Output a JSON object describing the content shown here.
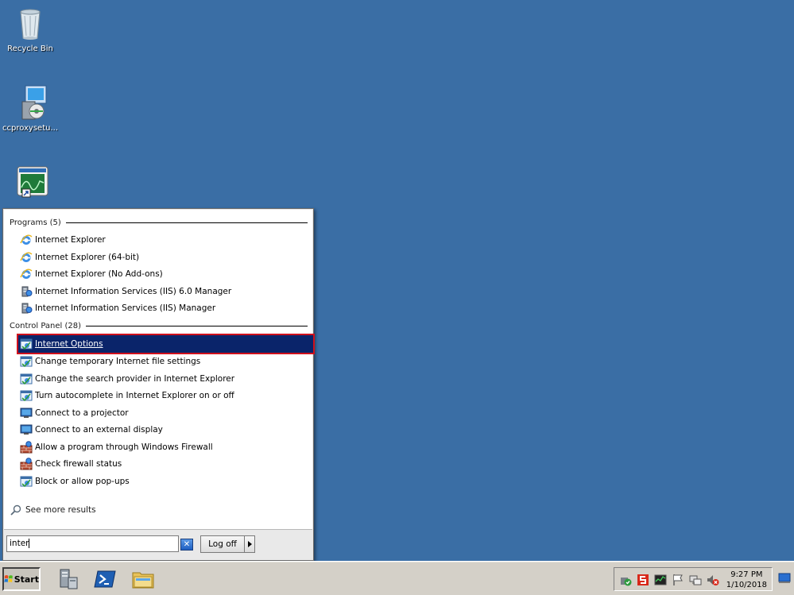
{
  "desktop": {
    "icons": [
      {
        "label": "Recycle Bin"
      },
      {
        "label": "ccproxysetu..."
      },
      {
        "label": "…"
      }
    ]
  },
  "start_menu": {
    "programs_header": "Programs (5)",
    "programs": [
      {
        "label": "Internet Explorer",
        "icon": "ie-icon"
      },
      {
        "label": "Internet Explorer (64-bit)",
        "icon": "ie-icon"
      },
      {
        "label": "Internet Explorer (No Add-ons)",
        "icon": "ie-icon"
      },
      {
        "label": "Internet Information Services (IIS) 6.0 Manager",
        "icon": "iis-icon"
      },
      {
        "label": "Internet Information Services (IIS) Manager",
        "icon": "iis-icon"
      }
    ],
    "control_panel_header": "Control Panel (28)",
    "control_panel": [
      {
        "label": "Internet Options",
        "icon": "internet-options-icon",
        "selected": true
      },
      {
        "label": "Change temporary Internet file settings",
        "icon": "internet-options-icon"
      },
      {
        "label": "Change the search provider in Internet Explorer",
        "icon": "internet-options-icon"
      },
      {
        "label": "Turn autocomplete in Internet Explorer on or off",
        "icon": "internet-options-icon"
      },
      {
        "label": "Connect to a projector",
        "icon": "display-icon"
      },
      {
        "label": "Connect to an external display",
        "icon": "display-icon"
      },
      {
        "label": "Allow a program through Windows Firewall",
        "icon": "firewall-icon"
      },
      {
        "label": "Check firewall status",
        "icon": "firewall-icon"
      },
      {
        "label": "Block or allow pop-ups",
        "icon": "internet-options-icon"
      }
    ],
    "see_more": "See more results",
    "search_value": "inter",
    "log_off_label": "Log off"
  },
  "taskbar": {
    "start_label": "Start",
    "clock_time": "9:27 PM",
    "clock_date": "1/10/2018"
  },
  "colors": {
    "desktop": "#3a6ea5",
    "selection": "#0a246a",
    "selection_outline": "#d0101c"
  }
}
